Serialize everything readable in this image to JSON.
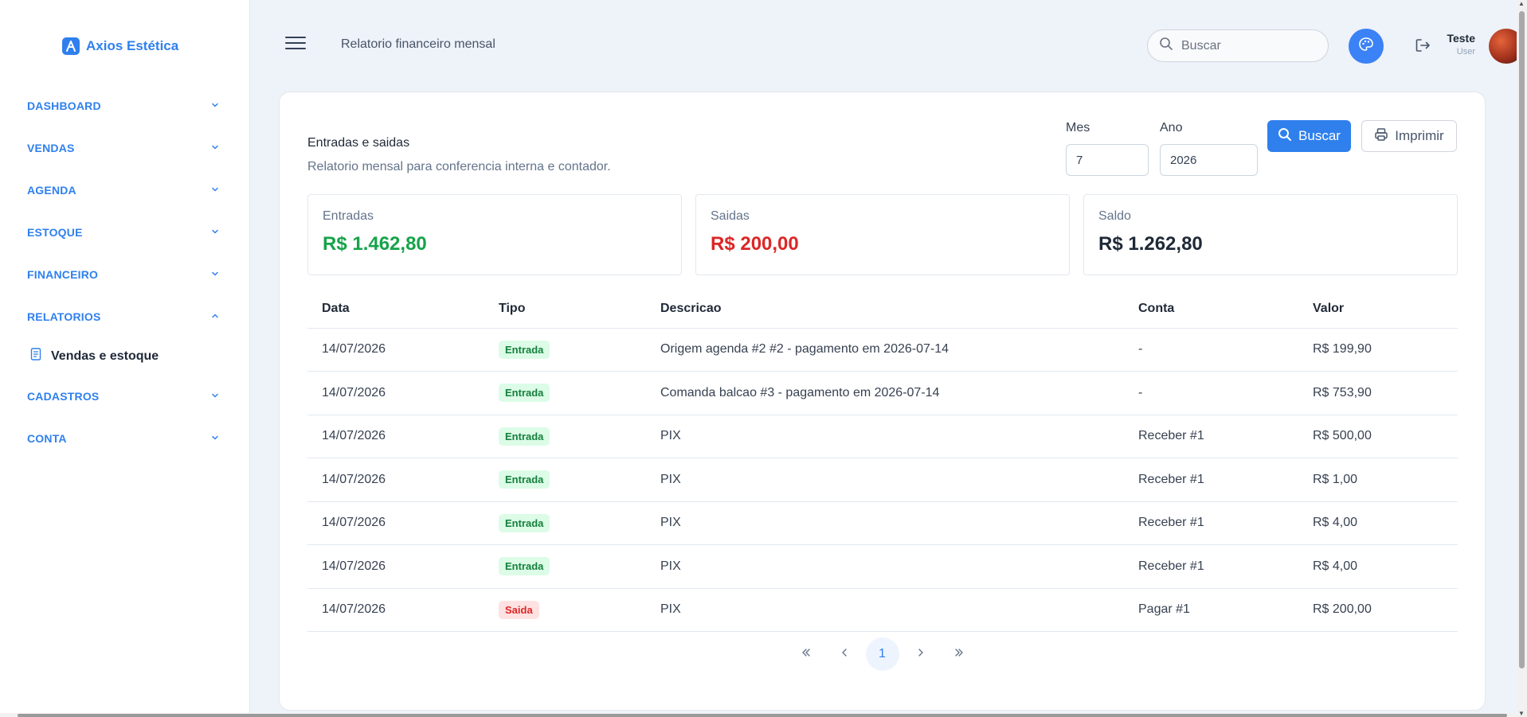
{
  "app": {
    "brand": "Axios Estética"
  },
  "sidebar": {
    "items": [
      {
        "label": "DASHBOARD",
        "expanded": false
      },
      {
        "label": "VENDAS",
        "expanded": false
      },
      {
        "label": "AGENDA",
        "expanded": false
      },
      {
        "label": "ESTOQUE",
        "expanded": false
      },
      {
        "label": "FINANCEIRO",
        "expanded": false
      },
      {
        "label": "RELATORIOS",
        "expanded": true,
        "subitems": [
          "Vendas e estoque"
        ]
      },
      {
        "label": "CADASTROS",
        "expanded": false
      },
      {
        "label": "CONTA",
        "expanded": false
      }
    ]
  },
  "header": {
    "title": "Relatorio financeiro mensal",
    "search_placeholder": "Buscar",
    "user": {
      "name": "Teste",
      "role": "User"
    }
  },
  "report": {
    "title": "Entradas e saidas",
    "subtitle": "Relatorio mensal para conferencia interna e contador.",
    "mes_label": "Mes",
    "mes_value": "7",
    "ano_label": "Ano",
    "ano_value": "2026",
    "search_button": "Buscar",
    "print_button": "Imprimir"
  },
  "summary": {
    "entradas": {
      "label": "Entradas",
      "value": "R$ 1.462,80",
      "color": "#16a34a"
    },
    "saidas": {
      "label": "Saidas",
      "value": "R$ 200,00",
      "color": "#dc2626"
    },
    "saldo": {
      "label": "Saldo",
      "value": "R$ 1.262,80",
      "color": "#1f2937"
    }
  },
  "table": {
    "headers": [
      "Data",
      "Tipo",
      "Descricao",
      "Conta",
      "Valor"
    ],
    "rows": [
      {
        "data": "14/07/2026",
        "tipo": "Entrada",
        "descricao": "Origem agenda #2 #2 - pagamento em 2026-07-14",
        "conta": "-",
        "valor": "R$ 199,90"
      },
      {
        "data": "14/07/2026",
        "tipo": "Entrada",
        "descricao": "Comanda balcao #3 - pagamento em 2026-07-14",
        "conta": "-",
        "valor": "R$ 753,90"
      },
      {
        "data": "14/07/2026",
        "tipo": "Entrada",
        "descricao": "PIX",
        "conta": "Receber #1",
        "valor": "R$ 500,00"
      },
      {
        "data": "14/07/2026",
        "tipo": "Entrada",
        "descricao": "PIX",
        "conta": "Receber #1",
        "valor": "R$ 1,00"
      },
      {
        "data": "14/07/2026",
        "tipo": "Entrada",
        "descricao": "PIX",
        "conta": "Receber #1",
        "valor": "R$ 4,00"
      },
      {
        "data": "14/07/2026",
        "tipo": "Entrada",
        "descricao": "PIX",
        "conta": "Receber #1",
        "valor": "R$ 4,00"
      },
      {
        "data": "14/07/2026",
        "tipo": "Saida",
        "descricao": "PIX",
        "conta": "Pagar #1",
        "valor": "R$ 200,00"
      }
    ]
  },
  "pagination": {
    "current_page": "1"
  },
  "colors": {
    "accent": "#2f80ed",
    "positive": "#16a34a",
    "negative": "#dc2626"
  }
}
